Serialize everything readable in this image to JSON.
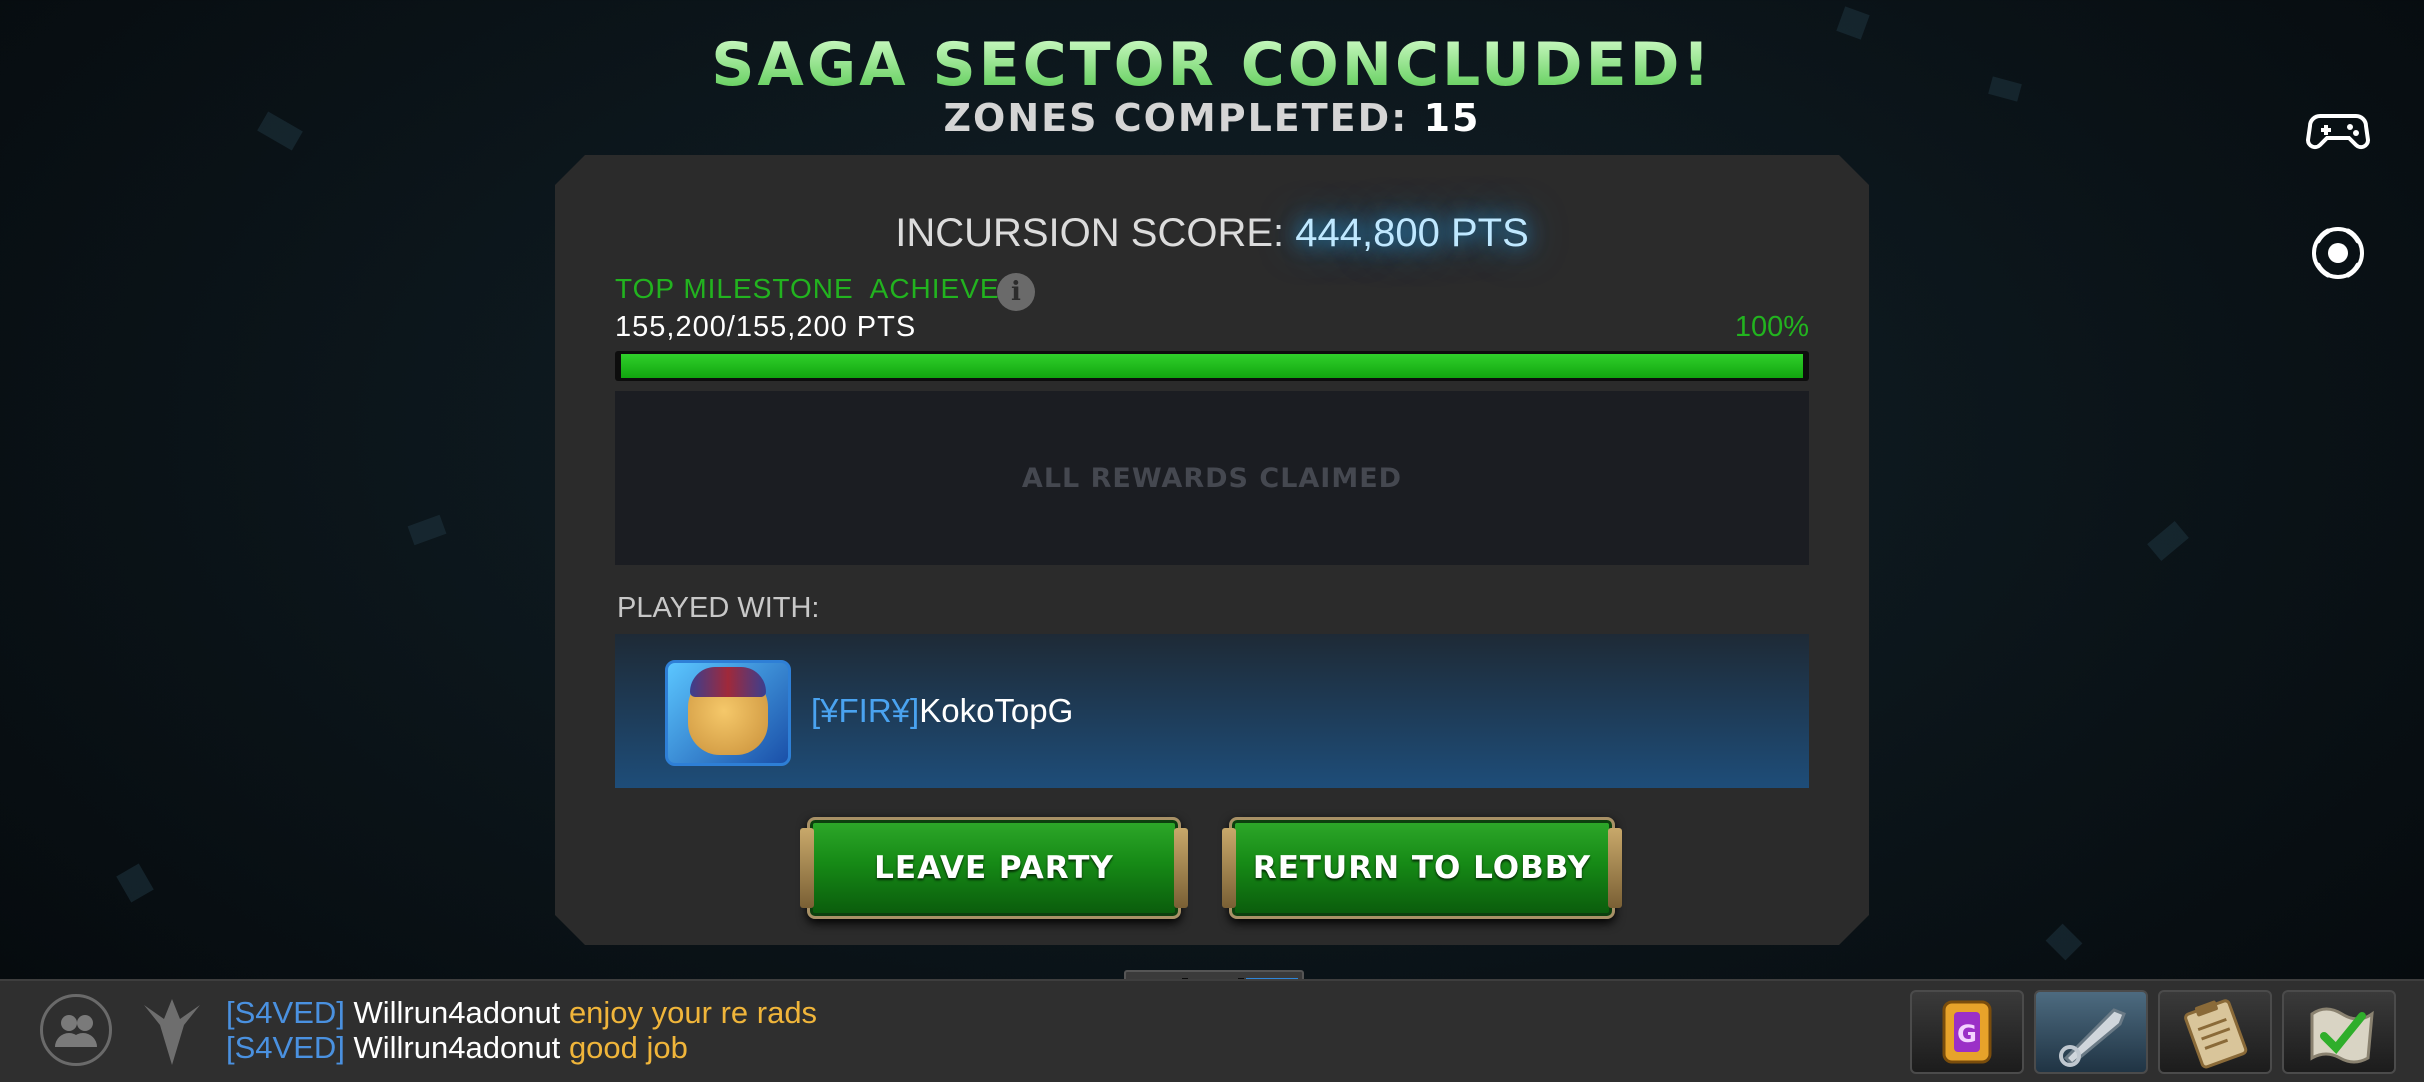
{
  "header": {
    "title": "SAGA SECTOR CONCLUDED!",
    "zones_label": "ZONES COMPLETED:",
    "zones_value": "15"
  },
  "side_icons": [
    "gamepad-icon",
    "record-icon"
  ],
  "panel": {
    "score_label": "INCURSION SCORE:",
    "score_value": "444,800 PTS",
    "milestone_text": "TOP MILESTONE  ACHIEVED",
    "points_text": "155,200/155,200 PTS",
    "percent_text": "100%",
    "progress": 1.0,
    "rewards_text": "ALL REWARDS CLAIMED",
    "played_with_label": "PLAYED WITH:",
    "player": {
      "tag": "[¥FIR¥]",
      "name": "KokoTopG"
    },
    "leave_label": "LEAVE PARTY",
    "lobby_label": "RETURN TO LOBBY"
  },
  "chat": [
    {
      "tag": "[S4VED]",
      "user": "Willrun4adonut",
      "message": "enjoy your re rads"
    },
    {
      "tag": "[S4VED]",
      "user": "Willrun4adonut",
      "message": "good job"
    }
  ],
  "bottom_icons": [
    "friends-icon",
    "alliance-icon",
    "crystal-chest-icon",
    "quest-sword-icon",
    "clipboard-icon",
    "checklist-icon"
  ],
  "colors": {
    "title_green": "#4fc64a",
    "progress_green": "#11a50f",
    "score_blue": "#bfe8ff",
    "alliance_tag_blue": "#4a91e0",
    "chat_message_orange": "#f0b53a",
    "button_green": "#168a16"
  }
}
